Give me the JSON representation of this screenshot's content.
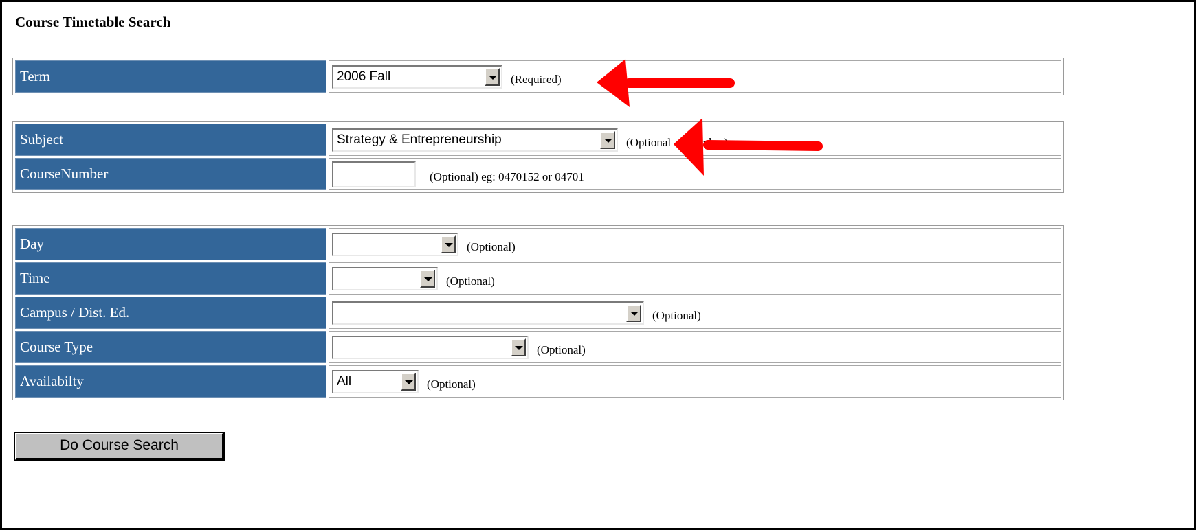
{
  "page": {
    "title": "Course Timetable Search"
  },
  "term": {
    "label": "Term",
    "value": "2006 Fall",
    "note": "(Required)"
  },
  "subject": {
    "label": "Subject",
    "value": "Strategy & Entrepreneurship",
    "note": "(Optional ... Number)"
  },
  "course_number": {
    "label": "CourseNumber",
    "value": "",
    "note": "(Optional) eg: 0470152 or 04701"
  },
  "day": {
    "label": "Day",
    "value": "",
    "note": "(Optional)"
  },
  "time": {
    "label": "Time",
    "value": "",
    "note": "(Optional)"
  },
  "campus": {
    "label": "Campus / Dist. Ed.",
    "value": "",
    "note": "(Optional)"
  },
  "course_type": {
    "label": "Course Type",
    "value": "",
    "note": "(Optional)"
  },
  "availability": {
    "label": "Availabilty",
    "value": "All",
    "note": "(Optional)"
  },
  "search_button": {
    "label": "Do Course Search"
  },
  "colors": {
    "label_bg": "#336699",
    "annotation_arrow": "#ff0000"
  },
  "annotations": [
    "red-arrow-term",
    "red-arrow-subject"
  ]
}
